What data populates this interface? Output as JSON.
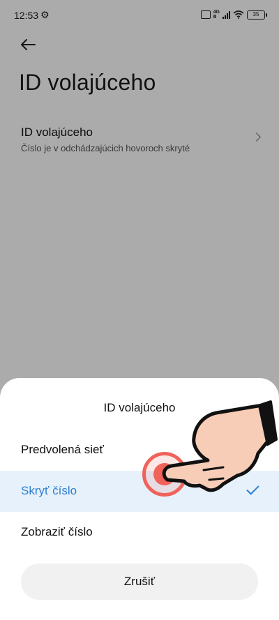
{
  "status_bar": {
    "time": "12:53",
    "battery": "35"
  },
  "page": {
    "title": "ID volajúceho"
  },
  "setting": {
    "title": "ID volajúceho",
    "subtitle": "Číslo je v odchádzajúcich hovoroch skryté"
  },
  "sheet": {
    "title": "ID volajúceho",
    "options": [
      {
        "label": "Predvolená sieť",
        "selected": false
      },
      {
        "label": "Skryť číslo",
        "selected": true
      },
      {
        "label": "Zobraziť číslo",
        "selected": false
      }
    ],
    "cancel_label": "Zrušiť"
  },
  "colors": {
    "accent": "#2d7fd1",
    "selected_bg": "#e6f1fb",
    "tap_indicator": "#f0625a"
  },
  "icons": [
    "gear-icon",
    "back-arrow-icon",
    "chevron-right-icon",
    "checkmark-icon",
    "wifi-icon",
    "signal-icon",
    "battery-icon"
  ]
}
